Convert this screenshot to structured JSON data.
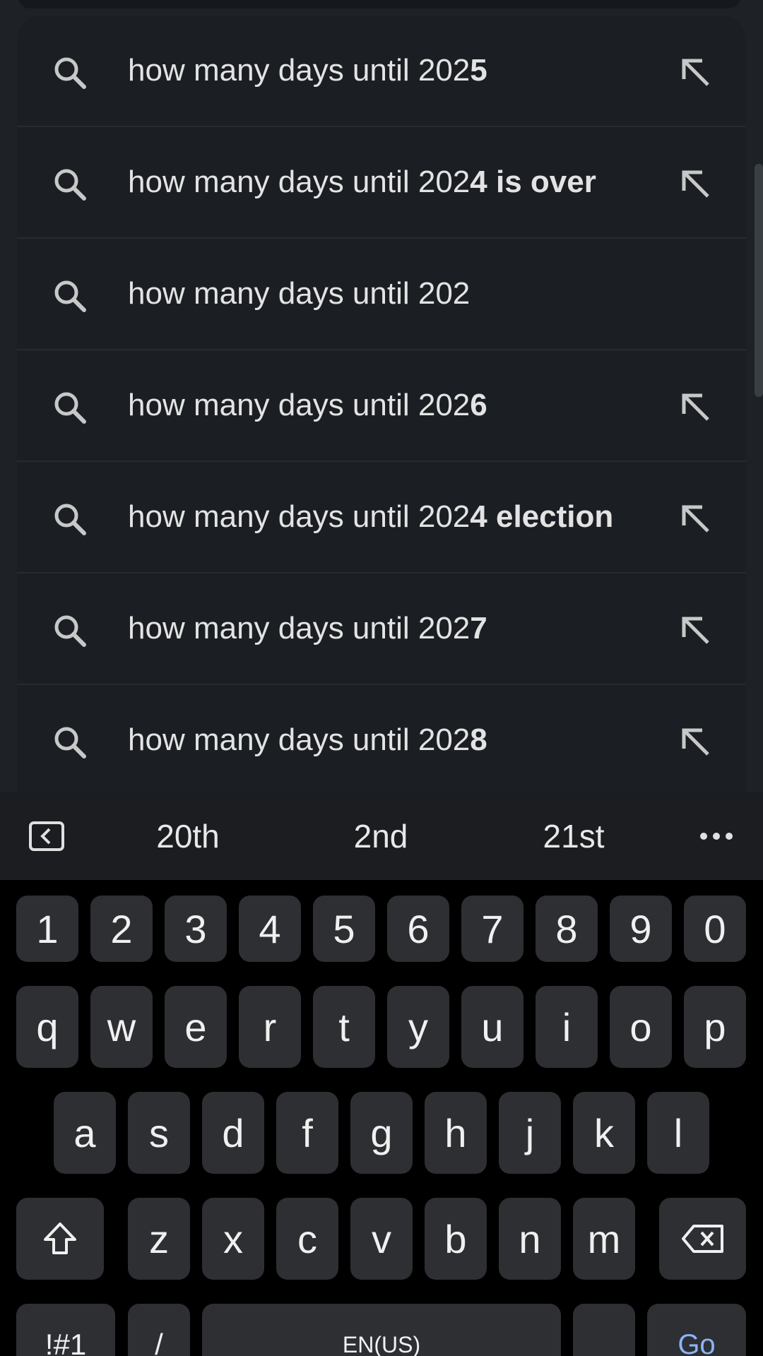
{
  "suggestions": [
    {
      "prefix": "how many days until 202",
      "suffix": "5",
      "has_arrow": true
    },
    {
      "prefix": "how many days until 202",
      "suffix": "4 is over",
      "has_arrow": true
    },
    {
      "prefix": "how many days until 202",
      "suffix": "",
      "has_arrow": false
    },
    {
      "prefix": "how many days until 202",
      "suffix": "6",
      "has_arrow": true
    },
    {
      "prefix": "how many days until 202",
      "suffix": "4 election",
      "has_arrow": true
    },
    {
      "prefix": "how many days until 202",
      "suffix": "7",
      "has_arrow": true
    },
    {
      "prefix": "how many days until 202",
      "suffix": "8",
      "has_arrow": true
    }
  ],
  "keyboard": {
    "strip_words": [
      "20th",
      "2nd",
      "21st"
    ],
    "row_numbers": [
      "1",
      "2",
      "3",
      "4",
      "5",
      "6",
      "7",
      "8",
      "9",
      "0"
    ],
    "row1": [
      "q",
      "w",
      "e",
      "r",
      "t",
      "y",
      "u",
      "i",
      "o",
      "p"
    ],
    "row2": [
      "a",
      "s",
      "d",
      "f",
      "g",
      "h",
      "j",
      "k",
      "l"
    ],
    "row3": [
      "z",
      "x",
      "c",
      "v",
      "b",
      "n",
      "m"
    ],
    "symbols_label": "!#1",
    "slash_label": "/",
    "space_label": "EN(US)",
    "go_label": "Go"
  },
  "icons": {
    "search": "search-icon",
    "fill_arrow": "arrow-up-left-icon",
    "strip_back": "keyboard-collapse-icon",
    "strip_more": "more-horizontal-icon",
    "shift": "shift-icon",
    "backspace": "backspace-icon"
  },
  "colors": {
    "panel": "#1b1f23",
    "key": "#2e2f33",
    "go": "#8ab4f8"
  }
}
